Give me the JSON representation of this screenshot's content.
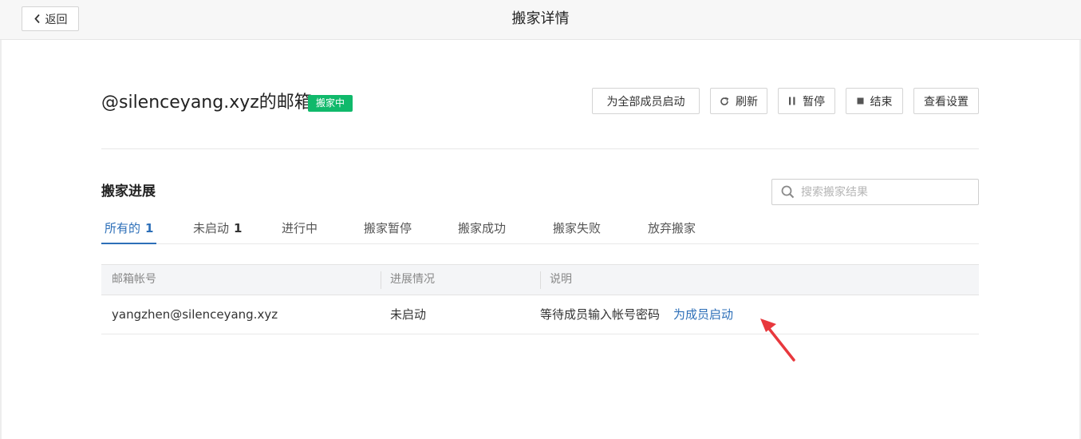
{
  "header": {
    "back_label": "返回",
    "title": "搬家详情"
  },
  "mailbox": {
    "title": "@silenceyang.xyz的邮箱",
    "status": "搬家中",
    "status_color": "#10b96b"
  },
  "actions": {
    "start_all": "为全部成员启动",
    "refresh": "刷新",
    "pause": "暂停",
    "end": "结束",
    "settings": "查看设置"
  },
  "progress": {
    "title": "搬家进展",
    "search_placeholder": "搜索搬家结果",
    "tabs": [
      {
        "label": "所有的",
        "count": "1"
      },
      {
        "label": "未启动",
        "count": "1"
      },
      {
        "label": "进行中",
        "count": ""
      },
      {
        "label": "搬家暂停",
        "count": ""
      },
      {
        "label": "搬家成功",
        "count": ""
      },
      {
        "label": "搬家失败",
        "count": ""
      },
      {
        "label": "放弃搬家",
        "count": ""
      }
    ],
    "active_tab": 0
  },
  "table": {
    "columns": [
      "邮箱帐号",
      "进展情况",
      "说明"
    ],
    "rows": [
      {
        "account": "yangzhen@silenceyang.xyz",
        "status": "未启动",
        "note": "等待成员输入帐号密码",
        "action": "为成员启动"
      }
    ]
  },
  "colors": {
    "accent": "#2d6fb8",
    "annotation_arrow": "#e8383d"
  },
  "icons": {
    "back": "chevron-left-icon",
    "refresh": "refresh-icon",
    "pause": "pause-icon",
    "end": "stop-icon",
    "search": "search-icon",
    "annotation": "red-arrow-icon"
  }
}
